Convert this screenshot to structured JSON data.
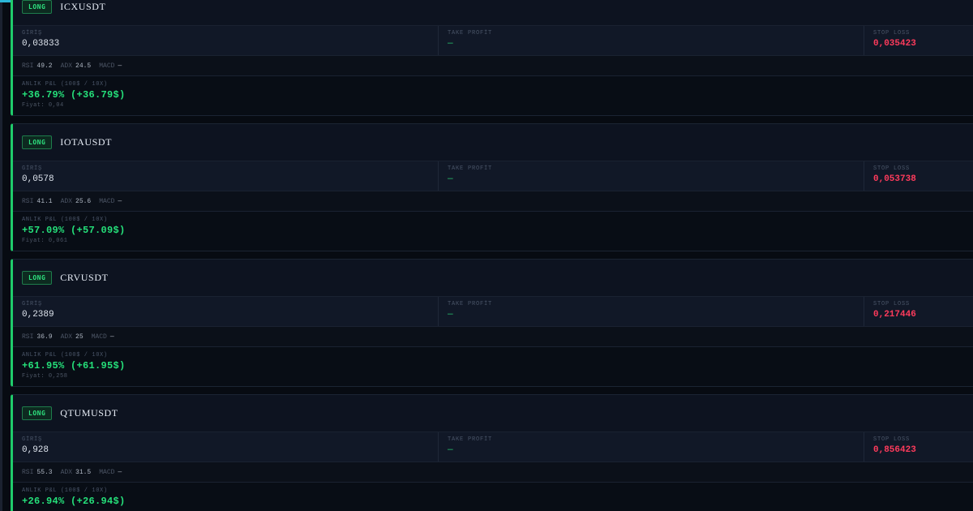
{
  "labels": {
    "entry": "GİRİŞ",
    "take_profit": "TAKE PROFİT",
    "stop_loss": "STOP LOSS",
    "pnl": "ANLIK P&L (100$ / 10X)",
    "rsi": "RSI",
    "adx": "ADX",
    "macd": "MACD",
    "price_prefix": "Fiyat:"
  },
  "colors": {
    "long": "#2ee07e",
    "stop_loss": "#ff3b5c",
    "accent": "#2bb7d8"
  },
  "positions": [
    {
      "side": "LONG",
      "symbol": "ICXUSDT",
      "entry": "0,03833",
      "take_profit": "—",
      "stop_loss": "0,035423",
      "rsi": "49.2",
      "adx": "24.5",
      "macd": "—",
      "pnl": "+36.79% (+36.79$)",
      "price": "Fiyat: 0,04"
    },
    {
      "side": "LONG",
      "symbol": "IOTAUSDT",
      "entry": "0,0578",
      "take_profit": "—",
      "stop_loss": "0,053738",
      "rsi": "41.1",
      "adx": "25.6",
      "macd": "—",
      "pnl": "+57.09% (+57.09$)",
      "price": "Fiyat: 0,061"
    },
    {
      "side": "LONG",
      "symbol": "CRVUSDT",
      "entry": "0,2389",
      "take_profit": "—",
      "stop_loss": "0,217446",
      "rsi": "36.9",
      "adx": "25",
      "macd": "—",
      "pnl": "+61.95% (+61.95$)",
      "price": "Fiyat: 0,258"
    },
    {
      "side": "LONG",
      "symbol": "QTUMUSDT",
      "entry": "0,928",
      "take_profit": "—",
      "stop_loss": "0,856423",
      "rsi": "55.3",
      "adx": "31.5",
      "macd": "—",
      "pnl": "+26.94% (+26.94$)",
      "price": ""
    }
  ]
}
